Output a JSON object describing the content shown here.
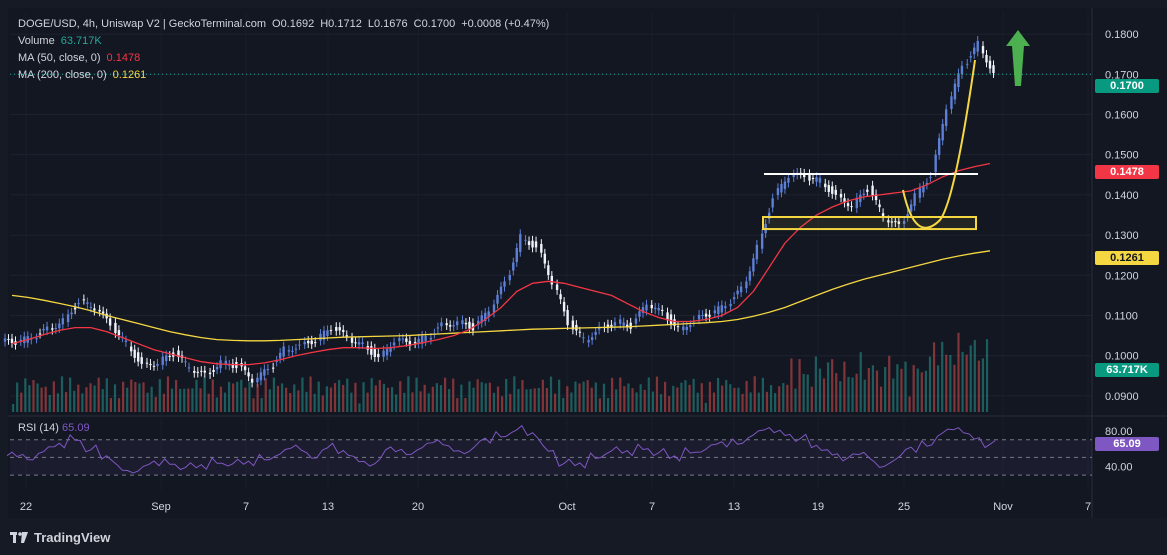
{
  "header": {
    "symbol": "DOGE/USD, 4h, Uniswap V2 | GeckoTerminal.com",
    "o_label": "O",
    "o": "0.1692",
    "h_label": "H",
    "h": "0.1712",
    "l_label": "L",
    "l": "0.1676",
    "c_label": "C",
    "c": "0.1700",
    "change": "+0.0008 (+0.47%)"
  },
  "volume": {
    "label": "Volume",
    "value": "63.717K"
  },
  "ma50": {
    "label": "MA (50, close, 0)",
    "value": "0.1478"
  },
  "ma200": {
    "label": "MA (200, close, 0)",
    "value": "0.1261"
  },
  "rsi": {
    "label": "RSI (14)",
    "value": "65.09"
  },
  "badges": {
    "price": "0.1700",
    "ma50": "0.1478",
    "ma200": "0.1261",
    "volume": "63.717K",
    "rsi": "65.09"
  },
  "footer": {
    "brand": "TradingView"
  },
  "colors": {
    "up": "#26a69a",
    "down": "#ef5350",
    "candle_up": "#5d7fd6",
    "candle_down": "#f0f3fa",
    "ma50": "#f23645",
    "ma200": "#f5d742",
    "rsi": "#7e57c2",
    "arrow": "#4caf50"
  },
  "chart_data": {
    "type": "candlestick",
    "price_axis": {
      "ticks": [
        "0.1800",
        "0.1700",
        "0.1600",
        "0.1500",
        "0.1400",
        "0.1300",
        "0.1200",
        "0.1100",
        "0.1000",
        "0.0900"
      ],
      "range": [
        0.086,
        0.1835
      ]
    },
    "rsi_axis": {
      "ticks": [
        "80.00",
        "40.00"
      ],
      "levels": [
        70,
        50,
        30
      ],
      "range": [
        20,
        90
      ]
    },
    "x_ticks": [
      "22",
      "Sep",
      "7",
      "13",
      "20",
      "Oct",
      "7",
      "13",
      "19",
      "25",
      "Nov",
      "7"
    ],
    "close_path": [
      0.1035,
      0.1045,
      0.1065,
      0.1088,
      0.1135,
      0.112,
      0.1075,
      0.103,
      0.0975,
      0.0985,
      0.1005,
      0.097,
      0.095,
      0.0985,
      0.0975,
      0.094,
      0.0965,
      0.1015,
      0.1025,
      0.104,
      0.107,
      0.1045,
      0.1025,
      0.0995,
      0.104,
      0.103,
      0.1045,
      0.1075,
      0.1085,
      0.107,
      0.1115,
      0.118,
      0.1295,
      0.127,
      0.1185,
      0.108,
      0.104,
      0.1065,
      0.1085,
      0.1075,
      0.113,
      0.1105,
      0.1065,
      0.109,
      0.1105,
      0.1125,
      0.1165,
      0.127,
      0.1395,
      0.145,
      0.1445,
      0.1435,
      0.1395,
      0.1375,
      0.1415,
      0.1345,
      0.132,
      0.14,
      0.145,
      0.162,
      0.172,
      0.1775,
      0.17
    ],
    "ma50": [
      0.103,
      0.104,
      0.1052,
      0.1063,
      0.107,
      0.107,
      0.106,
      0.1045,
      0.103,
      0.1015,
      0.1005,
      0.0995,
      0.0985,
      0.098,
      0.0978,
      0.0978,
      0.0982,
      0.099,
      0.1,
      0.1008,
      0.1015,
      0.102,
      0.102,
      0.1018,
      0.102,
      0.1025,
      0.1032,
      0.104,
      0.105,
      0.1065,
      0.109,
      0.112,
      0.116,
      0.118,
      0.1185,
      0.118,
      0.117,
      0.116,
      0.115,
      0.113,
      0.111,
      0.1095,
      0.1085,
      0.1085,
      0.109,
      0.11,
      0.112,
      0.116,
      0.122,
      0.128,
      0.132,
      0.135,
      0.137,
      0.1385,
      0.1395,
      0.14,
      0.1405,
      0.141,
      0.1425,
      0.1445,
      0.146,
      0.147,
      0.1478
    ],
    "ma200": [
      0.115,
      0.1145,
      0.1138,
      0.113,
      0.1122,
      0.1112,
      0.11,
      0.109,
      0.108,
      0.107,
      0.106,
      0.1052,
      0.1045,
      0.104,
      0.1038,
      0.1037,
      0.1037,
      0.1038,
      0.104,
      0.1042,
      0.1044,
      0.1046,
      0.1047,
      0.1048,
      0.1049,
      0.105,
      0.1052,
      0.1054,
      0.1056,
      0.1058,
      0.106,
      0.1062,
      0.1064,
      0.1066,
      0.1067,
      0.1068,
      0.1069,
      0.107,
      0.1071,
      0.1072,
      0.1074,
      0.1076,
      0.1078,
      0.108,
      0.1082,
      0.1085,
      0.109,
      0.1098,
      0.1108,
      0.112,
      0.1135,
      0.115,
      0.1165,
      0.1178,
      0.119,
      0.12,
      0.121,
      0.122,
      0.123,
      0.124,
      0.1248,
      0.1255,
      0.1261
    ],
    "rsi_path": [
      52,
      50,
      58,
      62,
      72,
      60,
      48,
      38,
      36,
      42,
      45,
      40,
      38,
      46,
      44,
      42,
      50,
      55,
      60,
      52,
      62,
      54,
      48,
      44,
      58,
      56,
      62,
      66,
      60,
      58,
      68,
      76,
      82,
      74,
      60,
      44,
      40,
      52,
      58,
      54,
      62,
      56,
      48,
      58,
      60,
      64,
      68,
      76,
      80,
      78,
      72,
      60,
      56,
      50,
      52,
      42,
      48,
      58,
      66,
      78,
      80,
      74,
      65
    ],
    "annotations": {
      "resistance_line": 0.1452,
      "support_box": [
        0.1315,
        0.1345
      ],
      "arrow": "up"
    }
  }
}
